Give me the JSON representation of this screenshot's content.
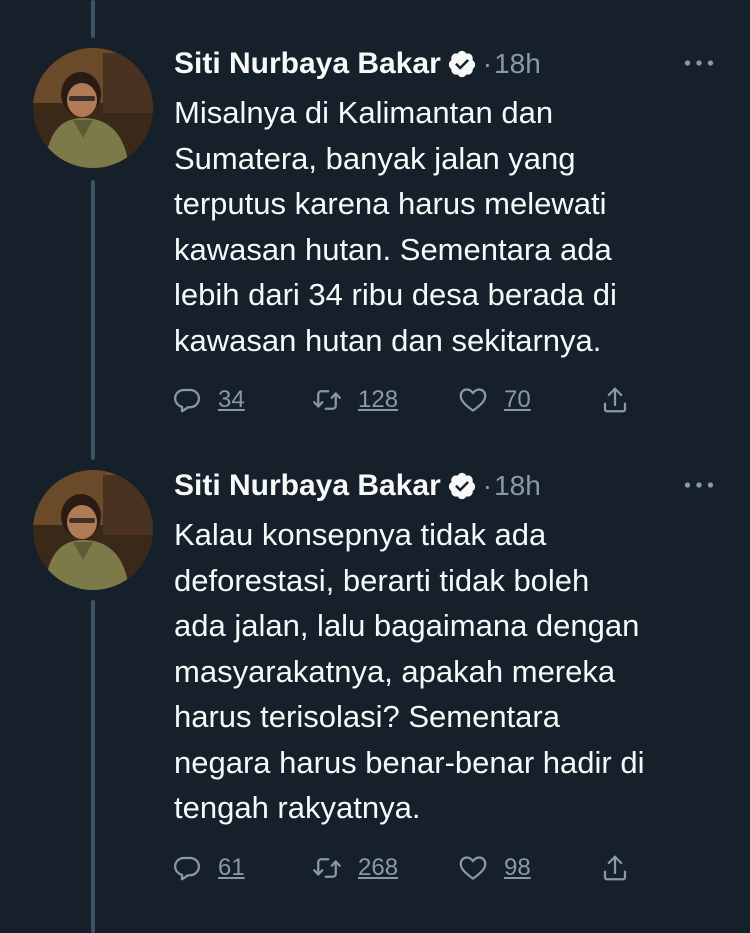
{
  "tweets": [
    {
      "author": "Siti Nurbaya Bakar",
      "separator": "·",
      "time": "18h",
      "text_lines": [
        "Misalnya di Kalimantan dan",
        "Sumatera, banyak jalan yang",
        "terputus karena harus melewati",
        "kawasan hutan. Sementara ada",
        "lebih dari 34 ribu desa berada di",
        "kawasan hutan dan sekitarnya."
      ],
      "replies": "34",
      "retweets": "128",
      "likes": "70"
    },
    {
      "author": "Siti Nurbaya Bakar",
      "separator": "·",
      "time": "18h",
      "text_lines": [
        "Kalau konsepnya tidak ada",
        "deforestasi, berarti tidak boleh",
        "ada jalan, lalu bagaimana dengan",
        "masyarakatnya, apakah mereka",
        "harus terisolasi? Sementara",
        "negara harus benar-benar hadir di",
        "tengah rakyatnya."
      ],
      "replies": "61",
      "retweets": "268",
      "likes": "98"
    }
  ],
  "icons": {
    "reply": "reply-icon",
    "retweet": "retweet-icon",
    "like": "heart-icon",
    "share": "share-icon",
    "more": "more-icon",
    "verified": "verified-badge-icon"
  },
  "colors": {
    "background": "#15202b",
    "text": "#f7f9f9",
    "secondary": "#8b98a5",
    "thread_line": "#3d5466"
  }
}
